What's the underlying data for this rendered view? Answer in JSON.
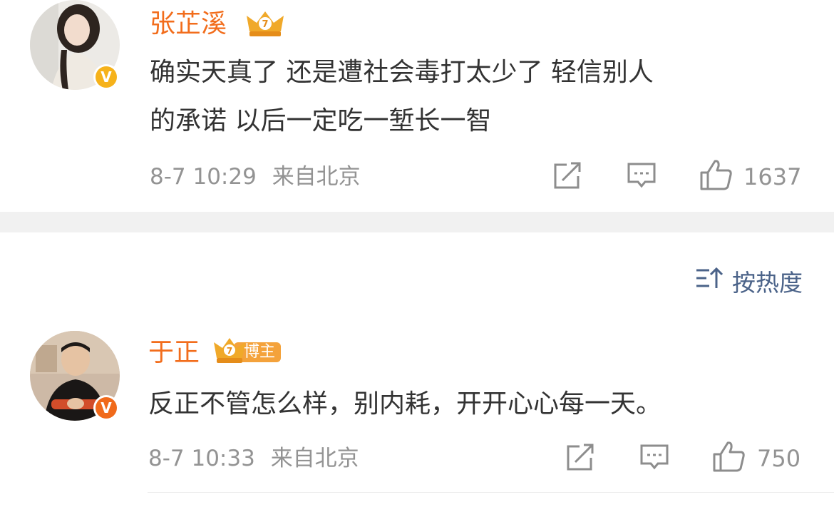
{
  "comments": [
    {
      "username": "张芷溪",
      "content_line1": "确实天真了 还是遭社会毒打太少了 轻信别人",
      "content_line2": "的承诺 以后一定吃一堑长一智",
      "timestamp": "8-7 10:29",
      "location": "来自北京",
      "likes": "1637",
      "verified_badge": "V",
      "badge_icon": "crown-badge-icon"
    },
    {
      "username": "于正",
      "content": "反正不管怎么样，别内耗，开开心心每一天。",
      "timestamp": "8-7 10:33",
      "location": "来自北京",
      "likes": "750",
      "verified_badge": "V",
      "badge_label": "博主",
      "badge_icon": "crown-blogger-badge-icon"
    }
  ],
  "sort": {
    "label": "按热度",
    "icon": "sort-icon"
  },
  "colors": {
    "username": "#f26d1c",
    "meta": "#939393",
    "sort": "#4b6389",
    "divider": "#f1f1f1"
  }
}
